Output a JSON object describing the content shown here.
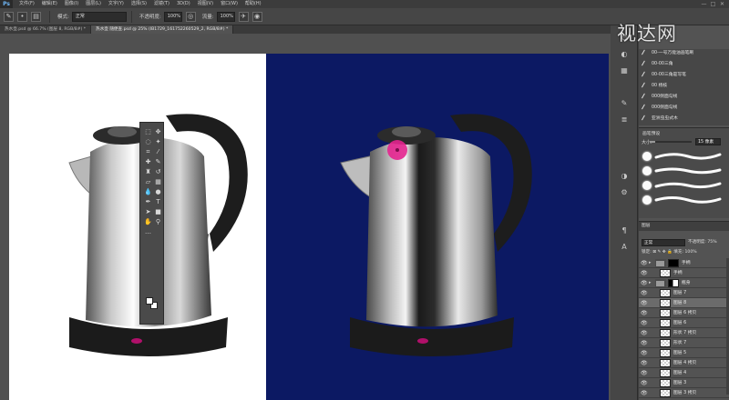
{
  "menubar": {
    "logo": "Ps",
    "items": [
      "文件(F)",
      "编辑(E)",
      "图像(I)",
      "图层(L)",
      "文字(Y)",
      "选择(S)",
      "滤镜(T)",
      "3D(D)",
      "视图(V)",
      "窗口(W)",
      "帮助(H)"
    ],
    "window_controls": [
      "—",
      "□",
      "✕"
    ]
  },
  "options": {
    "mode_label": "模式:",
    "mode_value": "正常",
    "opacity_label": "不透明度:",
    "opacity_value": "100%",
    "flow_label": "流量:",
    "flow_value": "100%"
  },
  "tabs": [
    {
      "label": "热水壶.psd @ 66.7% (图层 8, RGB/8#) *",
      "active": false
    },
    {
      "label": "热水壶 随便查.psd @ 25% (IB1729_161752260529_2, RGB/8#) *",
      "active": true
    }
  ],
  "watermark": "视达网",
  "brushes": {
    "items": [
      "00-一号万能油画笔刷",
      "00-00三角",
      "00-00三角是写笔",
      "00 杨枝",
      "000侧面勾线",
      "000侧面勾线",
      "亚洲虫虫式木"
    ]
  },
  "brush_settings": {
    "title": "画笔预设",
    "size_label": "大小:",
    "size_value": "15 像素",
    "size_fraction": 0.12
  },
  "layers": {
    "tab": "图层",
    "blend_mode": "正常",
    "opacity_text": "不透明度: 75%",
    "lock_text": "锁定: ⊠ ✎ ✥ 🔒 填充: 100%",
    "rows": [
      {
        "name": "手柄",
        "type": "group",
        "indent": 0,
        "selected": false
      },
      {
        "name": "手柄",
        "type": "layer",
        "indent": 1,
        "selected": false
      },
      {
        "name": "瓶身",
        "type": "group",
        "indent": 0,
        "selected": false
      },
      {
        "name": "图层 7",
        "type": "layer",
        "indent": 1,
        "selected": false
      },
      {
        "name": "图层 8",
        "type": "layer",
        "indent": 1,
        "selected": true
      },
      {
        "name": "图层 6 拷贝",
        "type": "layer",
        "indent": 1,
        "selected": false
      },
      {
        "name": "图层 6",
        "type": "layer",
        "indent": 1,
        "selected": false
      },
      {
        "name": "形状 7 拷贝",
        "type": "layer",
        "indent": 1,
        "selected": false
      },
      {
        "name": "形状 7",
        "type": "layer",
        "indent": 1,
        "selected": false
      },
      {
        "name": "图层 5",
        "type": "layer",
        "indent": 1,
        "selected": false
      },
      {
        "name": "图层 4 拷贝",
        "type": "layer",
        "indent": 1,
        "selected": false
      },
      {
        "name": "图层 4",
        "type": "layer",
        "indent": 1,
        "selected": false
      },
      {
        "name": "图层 3",
        "type": "layer",
        "indent": 1,
        "selected": false
      },
      {
        "name": "图层 3 拷贝",
        "type": "layer",
        "indent": 1,
        "selected": false
      }
    ]
  },
  "colors": {
    "canvas_left": "#ffffff",
    "canvas_right": "#0c1963",
    "brush_cursor": "#e4248f",
    "power_light": "#b0106a"
  },
  "icons": {
    "tools": [
      "rect-marquee-icon",
      "move-icon",
      "lasso-icon",
      "magic-wand-icon",
      "crop-icon",
      "eyedropper-icon",
      "healing-icon",
      "brush-icon",
      "stamp-icon",
      "history-brush-icon",
      "eraser-icon",
      "gradient-icon",
      "blur-icon",
      "dodge-icon",
      "pen-icon",
      "type-icon",
      "path-select-icon",
      "shape-icon",
      "hand-icon",
      "zoom-icon"
    ]
  }
}
